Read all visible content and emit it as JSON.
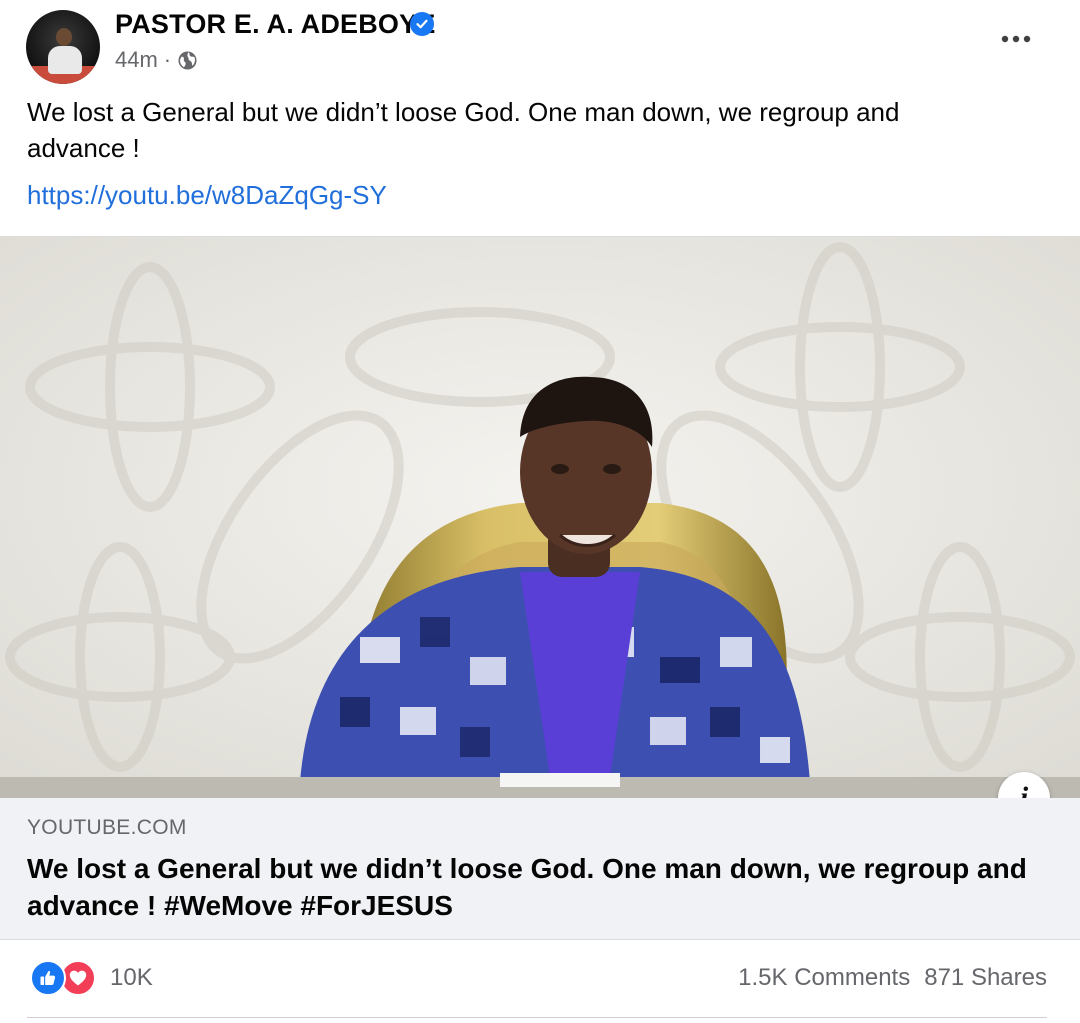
{
  "post": {
    "author": "PASTOR E. A. ADEBOYE",
    "verified": true,
    "time": "44m",
    "audience_icon": "globe-icon",
    "more_icon": "more-horizontal-icon",
    "text": "We lost a General but we didn’t loose God. One man down, we regroup and advance !",
    "link": "https://youtu.be/w8DaZqGg-SY"
  },
  "link_preview": {
    "domain": "YOUTUBE.COM",
    "title": "We lost a General but we didn’t loose God. One man down, we regroup and advance ! #WeMove #ForJESUS",
    "info_icon": "info-icon"
  },
  "footer": {
    "reaction_icons": [
      "like-icon",
      "love-icon"
    ],
    "reaction_count": "10K",
    "comments": "1.5K Comments",
    "shares": "871 Shares"
  },
  "colors": {
    "link": "#216fdb",
    "verified": "#1877f2",
    "like": "#1877f2",
    "love": "#f33e58",
    "secondary_text": "#65676b",
    "card_bg": "#f0f2f5"
  }
}
